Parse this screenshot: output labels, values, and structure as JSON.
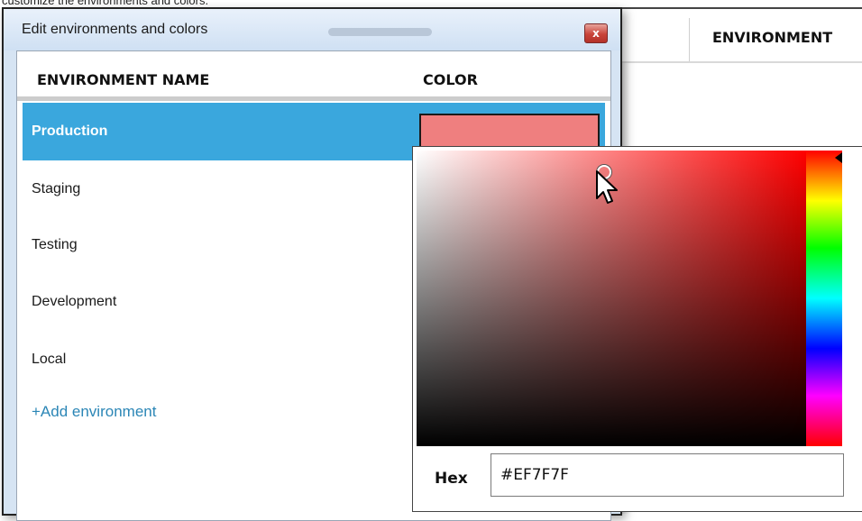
{
  "caption": "customize the environments and colors.",
  "background_window": {
    "header_title": "ENVIRONMENT"
  },
  "dialog": {
    "title": "Edit environments and colors",
    "close_label": "x",
    "columns": {
      "name": "ENVIRONMENT NAME",
      "color": "COLOR"
    },
    "environments": [
      {
        "name": "Production",
        "selected": true,
        "color": "#EF7F7F"
      },
      {
        "name": "Staging",
        "selected": false
      },
      {
        "name": "Testing",
        "selected": false
      },
      {
        "name": "Development",
        "selected": false
      },
      {
        "name": "Local",
        "selected": false
      }
    ],
    "add_label": "+Add environment"
  },
  "picker": {
    "hex_label": "Hex",
    "hex_value": "#EF7F7F",
    "hue_color": "#FF0000"
  },
  "colors": {
    "selected_row": "#3AA7DD",
    "link": "#2B86B6"
  }
}
